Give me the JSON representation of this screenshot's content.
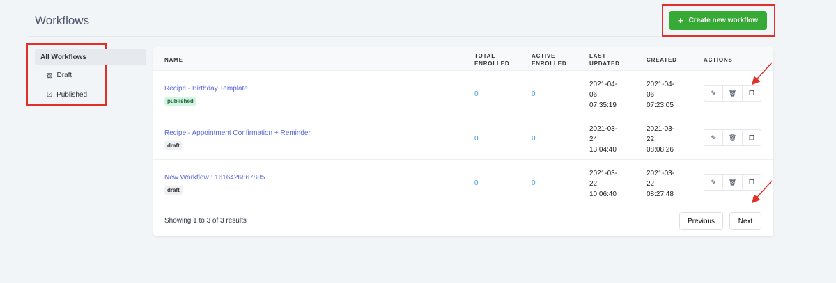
{
  "header": {
    "title": "Workflows",
    "create_label": "Create new workflow",
    "create_icon": "+"
  },
  "sidebar": {
    "items": [
      {
        "label": "All Workflows"
      },
      {
        "label": "Draft",
        "icon": "draft-icon"
      },
      {
        "label": "Published",
        "icon": "published-icon"
      }
    ]
  },
  "table": {
    "headers": {
      "name": "NAME",
      "total1": "TOTAL",
      "total2": "ENROLLED",
      "active1": "ACTIVE",
      "active2": "ENROLLED",
      "updated1": "LAST",
      "updated2": "UPDATED",
      "created": "CREATED",
      "actions": "ACTIONS"
    },
    "rows": [
      {
        "name": "Recipe - Birthday Template",
        "status": "published",
        "total": "0",
        "active": "0",
        "updated": [
          "2021-04-",
          "06",
          "07:35:19"
        ],
        "created": [
          "2021-04-",
          "06",
          "07:23:05"
        ]
      },
      {
        "name": "Recipe - Appointment Confirmation + Reminder",
        "status": "draft",
        "total": "0",
        "active": "0",
        "updated": [
          "2021-03-",
          "24",
          "13:04:40"
        ],
        "created": [
          "2021-03-",
          "22",
          "08:08:26"
        ]
      },
      {
        "name": "New Workflow : 1616426867885",
        "status": "draft",
        "total": "0",
        "active": "0",
        "updated": [
          "2021-03-",
          "22",
          "10:06:40"
        ],
        "created": [
          "2021-03-",
          "22",
          "08:27:48"
        ]
      }
    ]
  },
  "footer": {
    "showing": "Showing 1 to 3 of 3 results",
    "previous": "Previous",
    "next": "Next"
  },
  "colors": {
    "accent": "#37a935",
    "link": "#5a67d8",
    "annotation": "#e0302a"
  }
}
